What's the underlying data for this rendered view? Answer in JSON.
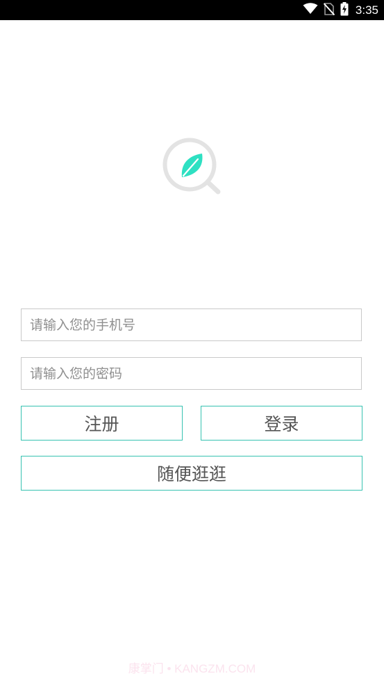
{
  "status_bar": {
    "time": "3:35",
    "icons": [
      "wifi-icon",
      "no-sim-icon",
      "battery-charging-icon"
    ]
  },
  "logo": {
    "icon": "leaf-search-logo-icon",
    "ring_color": "#e3e3e3",
    "leaf_color": "#2ee0c2"
  },
  "form": {
    "phone_placeholder": "请输入您的手机号",
    "phone_value": "",
    "password_placeholder": "请输入您的密码",
    "password_value": ""
  },
  "buttons": {
    "register_label": "注册",
    "login_label": "登录",
    "browse_label": "随便逛逛"
  },
  "colors": {
    "accent": "#36c2b1",
    "field_border": "#c9c9c9"
  },
  "watermark": "康掌门 • KANGZM.COM"
}
